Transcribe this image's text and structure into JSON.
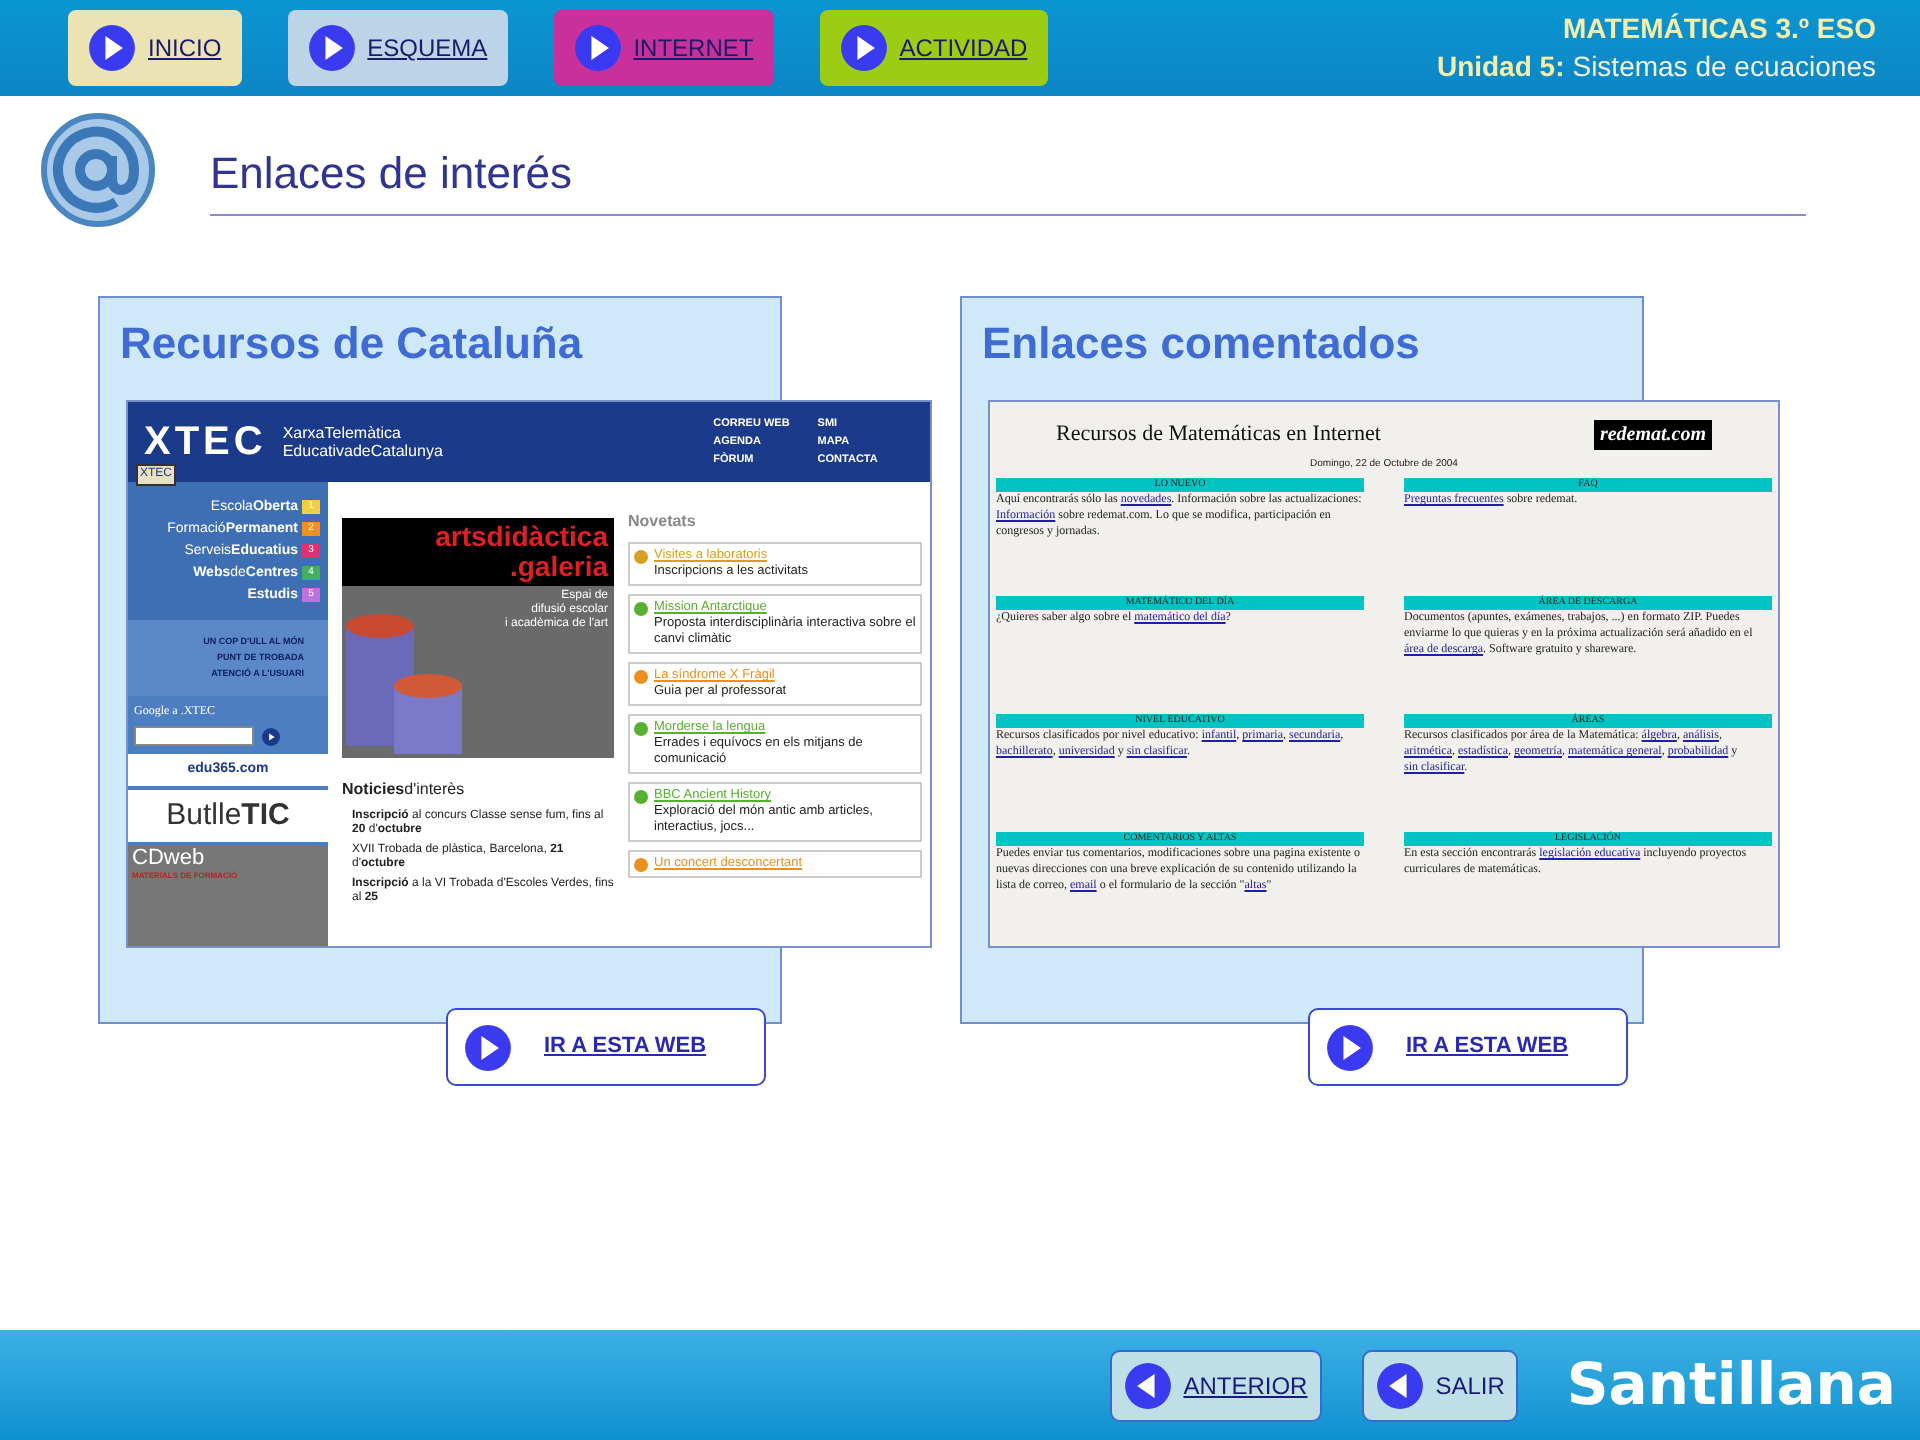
{
  "nav_buttons": [
    {
      "label": "INICIO",
      "color": "#ece3b4"
    },
    {
      "label": "ESQUEMA",
      "color": "#bcd3e8"
    },
    {
      "label": "INTERNET",
      "color": "#c8309c"
    },
    {
      "label": "ACTIVIDAD",
      "color": "#9ccc14"
    }
  ],
  "course": {
    "title": "MATEMÁTICAS 3.º ESO",
    "unit_label": "Unidad 5:",
    "unit_name": "Sistemas de ecuaciones"
  },
  "page_title": "Enlaces de interés",
  "cards": [
    {
      "title": "Recursos de Cataluña",
      "kind": "xtec",
      "button": "IR A ESTA WEB",
      "site": {
        "logo": "XTEC",
        "badge": "XTEC",
        "tagline": [
          "XarxaTelemàtica",
          "EducativadeCatalunya"
        ],
        "top_links": [
          "CORREU WEB",
          "SMI",
          "AGENDA",
          "MAPA",
          "FÒRUM",
          "CONTACTA"
        ],
        "menu": [
          {
            "label": "Escola**Oberta**",
            "number": "1",
            "color": "#f0d040"
          },
          {
            "label": "Formació**Permanent**",
            "number": "2",
            "color": "#f09020"
          },
          {
            "label": "Serveis**Educatius**",
            "number": "3",
            "color": "#e03070"
          },
          {
            "label": "**Webs**de**Centres**",
            "number": "4",
            "color": "#40b060"
          },
          {
            "label": "**Estudis**",
            "number": "5",
            "color": "#c070e0"
          }
        ],
        "secondary_links": [
          "UN COP D'ULL AL MÓN",
          "PUNT DE TROBADA",
          "ATENCIÓ A L'USUARI"
        ],
        "search_label": "Google a .XTEC",
        "banners": [
          "edu365.com",
          "Butlle**TIC**",
          "CDweb"
        ],
        "banner_caption": "MATERIALS DE FORMACIÓ",
        "art_banner": {
          "title": [
            "artsdidàctica",
            ".galeria"
          ],
          "caption": [
            "Espai de",
            "difusió escolar",
            "i acadèmica de l'art"
          ]
        },
        "news_heading": "**Noticies**d'interès",
        "news": [
          "**Inscripció** al concurs Classe sense fum, fins al **20** d'**octubre**",
          "XVII Trobada de plàstica, Barcelona, **21** d'**octubre**",
          "**Inscripció** a la VI Trobada d'Escoles Verdes, fins al **25**"
        ],
        "novetats_heading": "Novetats",
        "novetats": [
          {
            "title": "Visites a laboratoris",
            "text": "Inscripcions a les activitats",
            "color": "#d8a020"
          },
          {
            "title": "Mission Antarctique",
            "text": "Proposta interdisciplinària interactiva sobre el canvi climàtic",
            "color": "#58b030"
          },
          {
            "title": "La síndrome X Fràgil",
            "text": "Guia per al professorat",
            "color": "#e89020"
          },
          {
            "title": "Morderse la lengua",
            "text": "Errades i equívocs en els mitjans de comunicació",
            "color": "#58b030"
          },
          {
            "title": "BBC Ancient History",
            "text": "Exploració del món antic amb articles, interactius, jocs...",
            "color": "#58b030"
          },
          {
            "title": "Un concert desconcertant",
            "color": "#e89020"
          }
        ]
      }
    },
    {
      "title": "Enlaces comentados",
      "kind": "redemat",
      "button": "IR A ESTA WEB",
      "site": {
        "title": "Recursos de Matemáticas en Internet",
        "logo": "redemat.com",
        "date": "Domingo, 22 de Octubre de 2004",
        "sections": [
          {
            "heading": "LO NUEVO",
            "text": [
              {
                "text": "Aquí encontrarás sólo las "
              },
              {
                "text": "novedades",
                "link": true
              },
              {
                "text": ". Información sobre las actualizaciones: "
              },
              {
                "text": "Información",
                "link": true
              },
              {
                "text": " sobre redemat.com. Lo que se modifica, participación en congresos y jornadas."
              }
            ]
          },
          {
            "heading": "FAQ",
            "text": [
              {
                "text": "Preguntas frecuentes",
                "link": true
              },
              {
                "text": " sobre redemat."
              }
            ]
          },
          {
            "heading": "MATEMÁTICO DEL DÍA",
            "text": [
              {
                "text": "¿Quieres saber algo sobre el "
              },
              {
                "text": "matemático del día",
                "link": true
              },
              {
                "text": "?"
              }
            ]
          },
          {
            "heading": "ÁREA DE DESCARGA",
            "text": [
              {
                "text": "Documentos (apuntes, exámenes, trabajos, ...) en formato ZIP. Puedes enviarme lo que quieras y en la próxima actualización será añadido en el "
              },
              {
                "text": "área de descarga",
                "link": true
              },
              {
                "text": ". Software gratuito y shareware."
              }
            ]
          },
          {
            "heading": "NIVEL EDUCATIVO",
            "text": [
              {
                "text": "Recursos clasificados por nivel educativo: "
              },
              {
                "text": "infantil",
                "link": true
              },
              {
                "text": ", "
              },
              {
                "text": "primaria",
                "link": true
              },
              {
                "text": ", "
              },
              {
                "text": "secundaria",
                "link": true
              },
              {
                "text": ", "
              },
              {
                "text": "bachillerato",
                "link": true
              },
              {
                "text": ", "
              },
              {
                "text": "universidad",
                "link": true
              },
              {
                "text": " y "
              },
              {
                "text": "sin clasificar",
                "link": true
              },
              {
                "text": "."
              }
            ]
          },
          {
            "heading": "ÁREAS",
            "text": [
              {
                "text": "Recursos clasificados por área de la Matemática: "
              },
              {
                "text": "álgebra",
                "link": true
              },
              {
                "text": ", "
              },
              {
                "text": "análisis",
                "link": true
              },
              {
                "text": ", "
              },
              {
                "text": "aritmética",
                "link": true
              },
              {
                "text": ", "
              },
              {
                "text": "estadística",
                "link": true
              },
              {
                "text": ", "
              },
              {
                "text": "geometría",
                "link": true
              },
              {
                "text": ", "
              },
              {
                "text": "matemática general",
                "link": true
              },
              {
                "text": ", "
              },
              {
                "text": "probabilidad",
                "link": true
              },
              {
                "text": " y "
              },
              {
                "text": "sin clasificar",
                "link": true
              },
              {
                "text": "."
              }
            ]
          },
          {
            "heading": "COMENTARIOS Y ALTAS",
            "text": [
              {
                "text": "Puedes enviar tus comentarios, modificaciones sobre una pagina existente o nuevas direcciones con una breve explicación de su contenido utilizando la lista de correo, "
              },
              {
                "text": "email",
                "link": true
              },
              {
                "text": " o el formulario de la sección \""
              },
              {
                "text": "altas",
                "link": true
              },
              {
                "text": "\""
              }
            ]
          },
          {
            "heading": "LEGISLACIÓN",
            "text": [
              {
                "text": "En esta sección encontrarás "
              },
              {
                "text": "legislación educativa",
                "link": true
              },
              {
                "text": " incluyendo proyectos curriculares de matemáticas."
              }
            ]
          }
        ]
      }
    }
  ],
  "footer": {
    "buttons": [
      {
        "label": "ANTERIOR",
        "kind": "link"
      },
      {
        "label": "SALIR",
        "kind": "plain"
      }
    ],
    "brand": "Santillana"
  }
}
